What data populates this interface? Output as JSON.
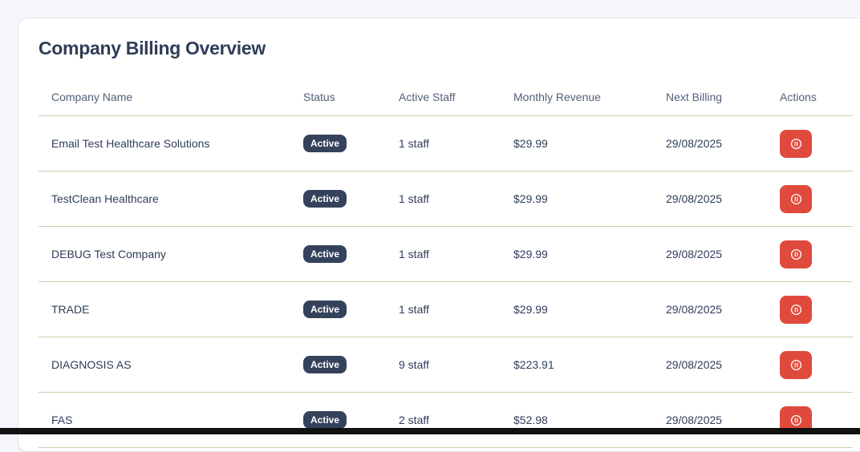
{
  "panel": {
    "title": "Company Billing Overview"
  },
  "table": {
    "headers": [
      "Company Name",
      "Status",
      "Active Staff",
      "Monthly Revenue",
      "Next Billing",
      "Actions"
    ],
    "rows": [
      {
        "company": "Email Test Healthcare Solutions",
        "status": "Active",
        "staff": "1 staff",
        "revenue": "$29.99",
        "next_billing": "29/08/2025"
      },
      {
        "company": "TestClean Healthcare",
        "status": "Active",
        "staff": "1 staff",
        "revenue": "$29.99",
        "next_billing": "29/08/2025"
      },
      {
        "company": "DEBUG Test Company",
        "status": "Active",
        "staff": "1 staff",
        "revenue": "$29.99",
        "next_billing": "29/08/2025"
      },
      {
        "company": "TRADE",
        "status": "Active",
        "staff": "1 staff",
        "revenue": "$29.99",
        "next_billing": "29/08/2025"
      },
      {
        "company": "DIAGNOSIS AS",
        "status": "Active",
        "staff": "9 staff",
        "revenue": "$223.91",
        "next_billing": "29/08/2025"
      },
      {
        "company": "FAS",
        "status": "Active",
        "staff": "2 staff",
        "revenue": "$52.98",
        "next_billing": "29/08/2025"
      }
    ],
    "action_icon": "pause-circle-icon"
  },
  "colors": {
    "badge_bg": "#35425c",
    "action_bg": "#e04a3c",
    "row_divider": "#cfcfae",
    "title_text": "#2f3d58"
  }
}
